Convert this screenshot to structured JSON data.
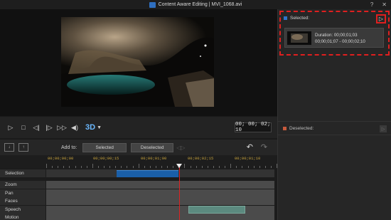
{
  "title": "Content Aware Editing  |  MVI_1068.avi",
  "titlebar": {
    "help": "?",
    "close": "✕"
  },
  "player": {
    "timecode": "00; 00; 02; 10",
    "seek_progress": 0.58,
    "three_d_label": "3D"
  },
  "selected_panel": {
    "header": "Selected:",
    "clip": {
      "duration": "Duration: 00;00;01;03",
      "range": "00;00;01;07 - 00;00;02;10"
    }
  },
  "deselected_panel": {
    "header": "Deselected:"
  },
  "timeline_toolbar": {
    "add_to": "Add to:",
    "selected_btn": "Selected",
    "deselected_btn": "Deselected"
  },
  "ruler": {
    "labels": [
      "00;00;00;00",
      "00;00;00;15",
      "00;00;01;00",
      "00;00;02;15",
      "00;00;01;10"
    ]
  },
  "tracks": [
    {
      "label": "Selection"
    },
    {
      "label": "Zoom"
    },
    {
      "label": "Pan"
    },
    {
      "label": "Faces"
    },
    {
      "label": "Speech"
    },
    {
      "label": "Motion"
    }
  ],
  "colors": {
    "accent": "#2f74c9",
    "highlight_border": "#e01f1f",
    "playhead": "#dd2222",
    "selection_clip": "#1a5fa8",
    "speech_clip": "#5c8a7f",
    "ruler_text": "#c6a23c"
  }
}
